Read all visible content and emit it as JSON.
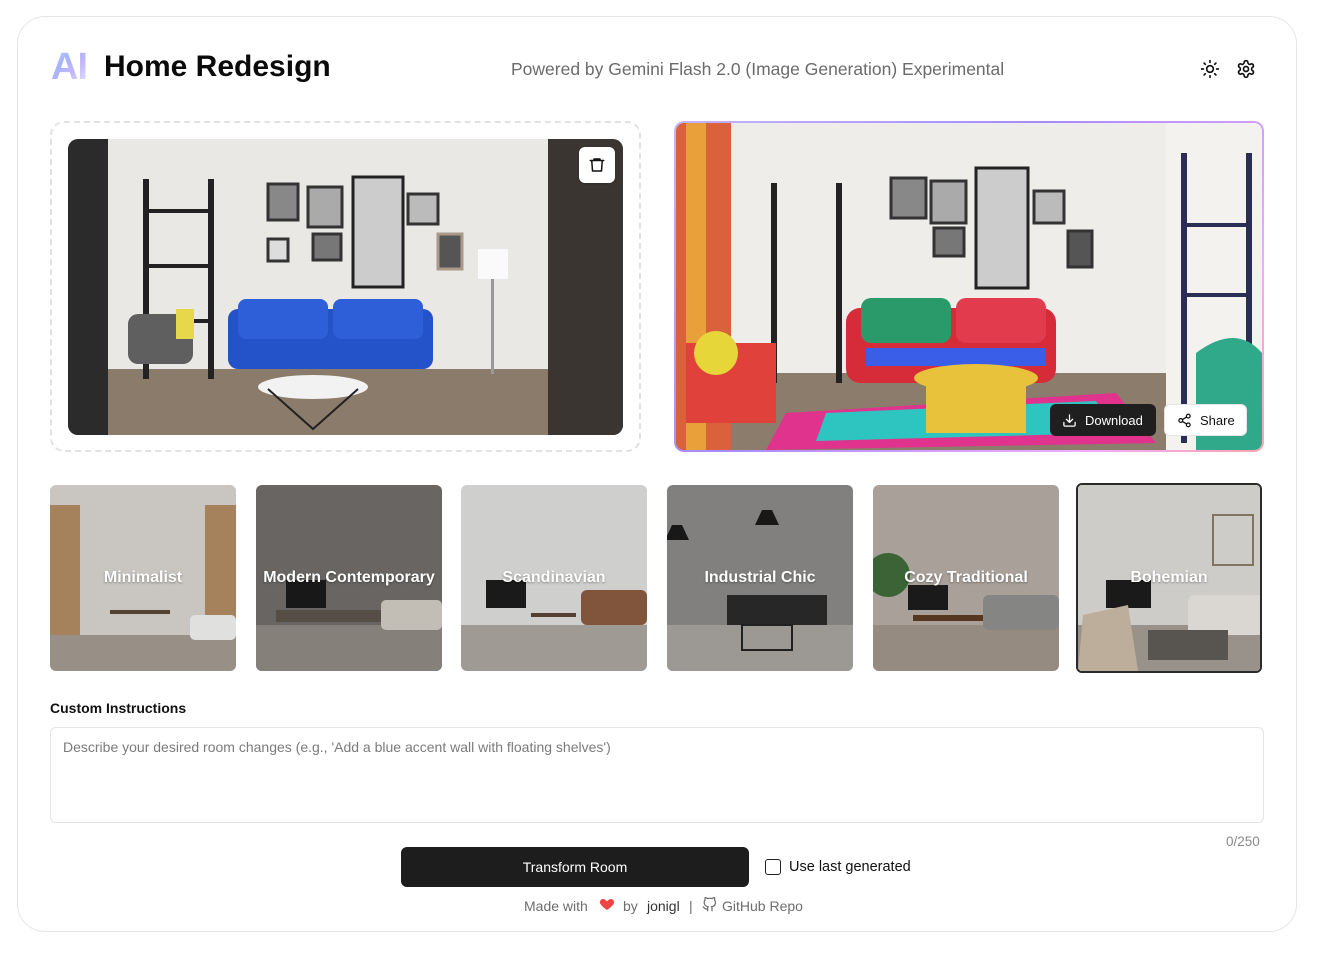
{
  "header": {
    "logo_text": "AI",
    "title": "Home Redesign",
    "subtitle": "Powered by Gemini Flash 2.0 (Image Generation) Experimental",
    "theme_icon": "sun-icon",
    "settings_icon": "gear-icon"
  },
  "original": {
    "delete_icon": "trash-icon"
  },
  "generated": {
    "download_label": "Download",
    "share_label": "Share"
  },
  "styles": [
    {
      "label": "Minimalist",
      "selected": false
    },
    {
      "label": "Modern Contemporary",
      "selected": false
    },
    {
      "label": "Scandinavian",
      "selected": false
    },
    {
      "label": "Industrial Chic",
      "selected": false
    },
    {
      "label": "Cozy Traditional",
      "selected": false
    },
    {
      "label": "Bohemian",
      "selected": true
    }
  ],
  "instructions": {
    "label": "Custom Instructions",
    "value": "",
    "placeholder": "Describe your desired room changes (e.g., 'Add a blue accent wall with floating shelves')",
    "counter": "0/250"
  },
  "actions": {
    "transform_label": "Transform Room",
    "use_last_label": "Use last generated",
    "use_last_checked": false
  },
  "footer": {
    "made_with": "Made with",
    "by": "by",
    "author": "jonigl",
    "separator": "|",
    "repo_label": "GitHub Repo"
  },
  "colors": {
    "accent_dark": "#1d1d1d",
    "heart": "#ef4444",
    "gradient_border": "#a78bfa"
  }
}
